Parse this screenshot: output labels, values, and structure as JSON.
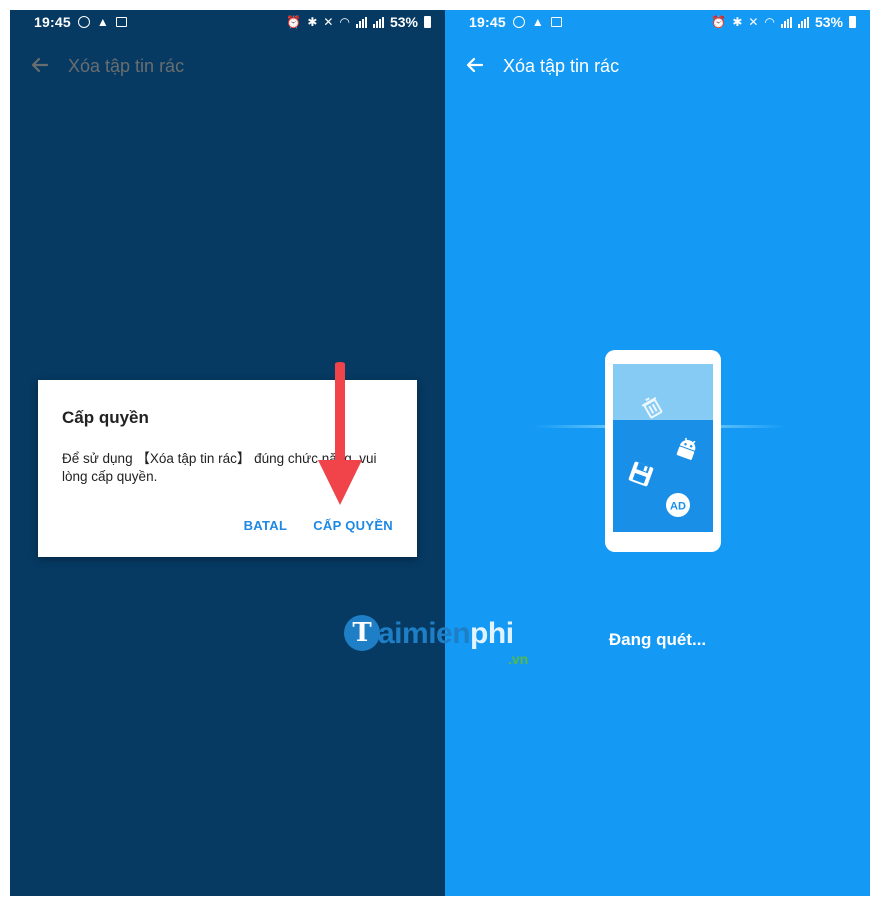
{
  "left": {
    "status": {
      "time": "19:45",
      "battery": "53%"
    },
    "appbar": {
      "title": "Xóa tập tin rác"
    },
    "dialog": {
      "title": "Cấp quyền",
      "message": "Để sử dụng 【Xóa tập tin rác】 đúng chức năng, vui lòng cấp quyền.",
      "cancel_label": "BATAL",
      "confirm_label": "CẤP QUYỀN"
    }
  },
  "right": {
    "status": {
      "time": "19:45",
      "battery": "53%"
    },
    "appbar": {
      "title": "Xóa tập tin rác"
    },
    "scan": {
      "status_text": "Đang quét..."
    }
  },
  "watermark": {
    "logo_letter": "T",
    "brand_part1": "aimien",
    "brand_part2": "phi",
    "tld": ".vn"
  },
  "colors": {
    "left_bg": "#063a63",
    "right_bg": "#149af5",
    "dialog_button": "#1e88e5",
    "arrow": "#f0434a"
  },
  "icons": [
    "back-arrow-icon",
    "alarm-icon",
    "bluetooth-icon",
    "mute-icon",
    "wifi-icon",
    "signal-icon",
    "battery-icon",
    "phone-icon",
    "trash-icon",
    "android-icon",
    "floppy-icon",
    "ad-icon"
  ]
}
